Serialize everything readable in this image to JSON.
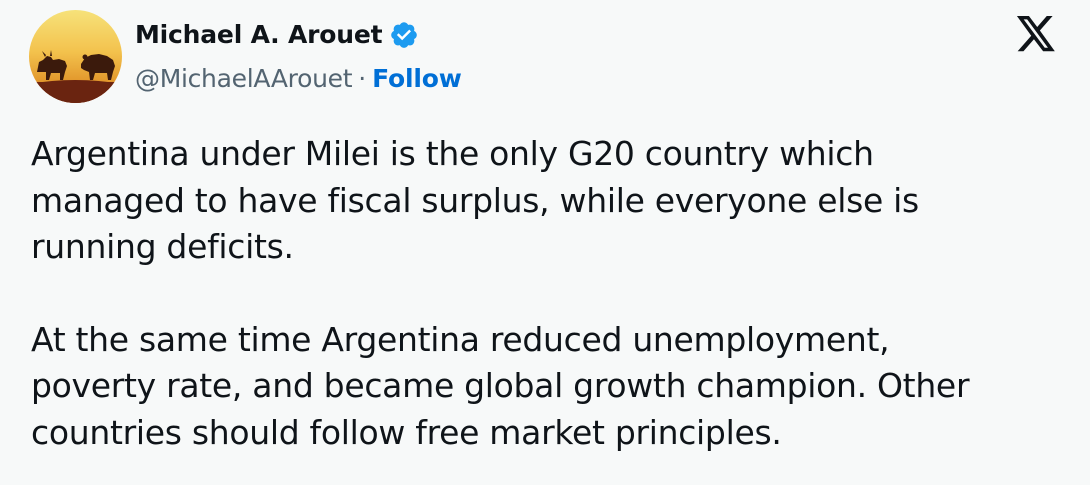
{
  "author": {
    "display_name": "Michael A. Arouet",
    "handle": "@MichaelAArouet",
    "separator": "·",
    "follow_label": "Follow",
    "verified": true,
    "avatar_icon": "bull-and-bear-sunset-avatar"
  },
  "platform": {
    "logo_icon": "x-logo-icon"
  },
  "tweet": {
    "paragraphs": [
      "Argentina under Milei is the only G20 country which\nmanaged to have fiscal surplus, while everyone else is\nrunning deficits.",
      "At the same time Argentina reduced unemployment,\npoverty rate, and became global growth champion. Other\ncountries should follow free market principles."
    ]
  },
  "colors": {
    "background": "#f7f9f9",
    "text": "#0f1419",
    "secondary_text": "#536471",
    "link": "#006fd6",
    "verified_badge": "#1d9bf0"
  }
}
